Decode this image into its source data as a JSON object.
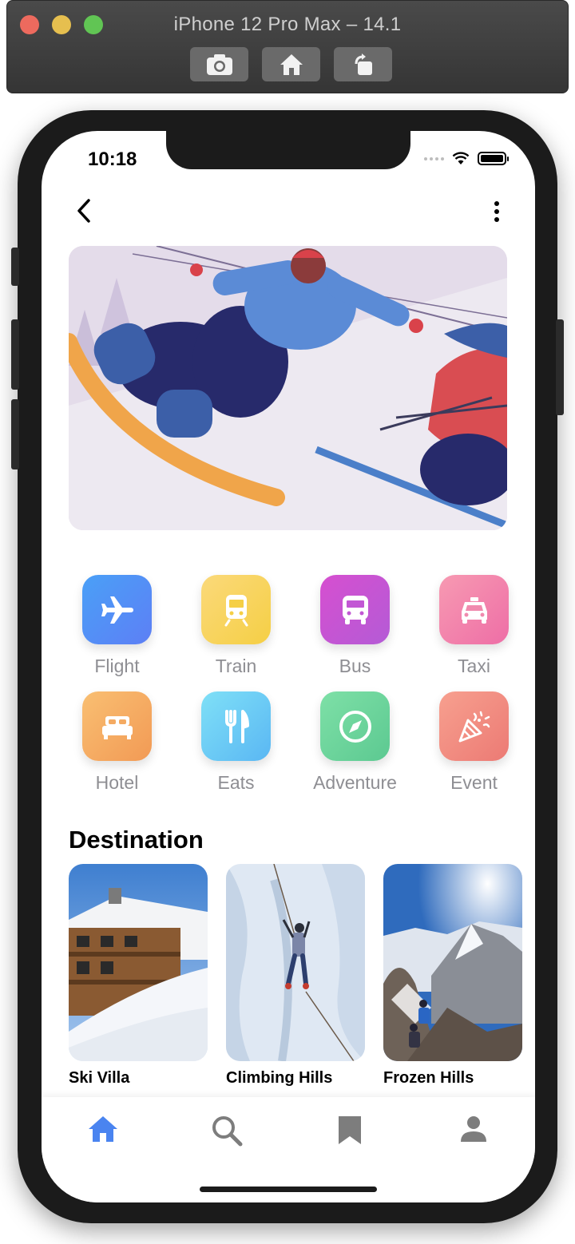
{
  "simulator": {
    "title": "iPhone 12 Pro Max – 14.1",
    "buttons": [
      "screenshot-icon",
      "home-icon",
      "rotate-icon"
    ]
  },
  "status_bar": {
    "time": "10:18"
  },
  "header": {
    "back_icon": "chevron-left-icon",
    "menu_icon": "more-vertical-icon"
  },
  "categories": [
    {
      "label": "Flight",
      "icon": "airplane-icon",
      "color": "#5b8df6"
    },
    {
      "label": "Train",
      "icon": "train-icon",
      "color": "#f6d55e"
    },
    {
      "label": "Bus",
      "icon": "bus-icon",
      "color": "#c85bd4"
    },
    {
      "label": "Taxi",
      "icon": "taxi-icon",
      "color": "#f07aa8"
    },
    {
      "label": "Hotel",
      "icon": "bed-icon",
      "color": "#f4a25a"
    },
    {
      "label": "Eats",
      "icon": "cutlery-icon",
      "color": "#6cc9f5"
    },
    {
      "label": "Adventure",
      "icon": "compass-icon",
      "color": "#6fd29a"
    },
    {
      "label": "Event",
      "icon": "party-icon",
      "color": "#f28a80"
    }
  ],
  "destination": {
    "title": "Destination",
    "items": [
      {
        "name": "Ski Villa"
      },
      {
        "name": "Climbing Hills"
      },
      {
        "name": "Frozen Hills"
      }
    ]
  },
  "tabbar": {
    "active_color": "#4a84f0",
    "inactive_color": "#7d7d7d",
    "items": [
      "home-icon",
      "search-icon",
      "bookmark-icon",
      "profile-icon"
    ]
  }
}
